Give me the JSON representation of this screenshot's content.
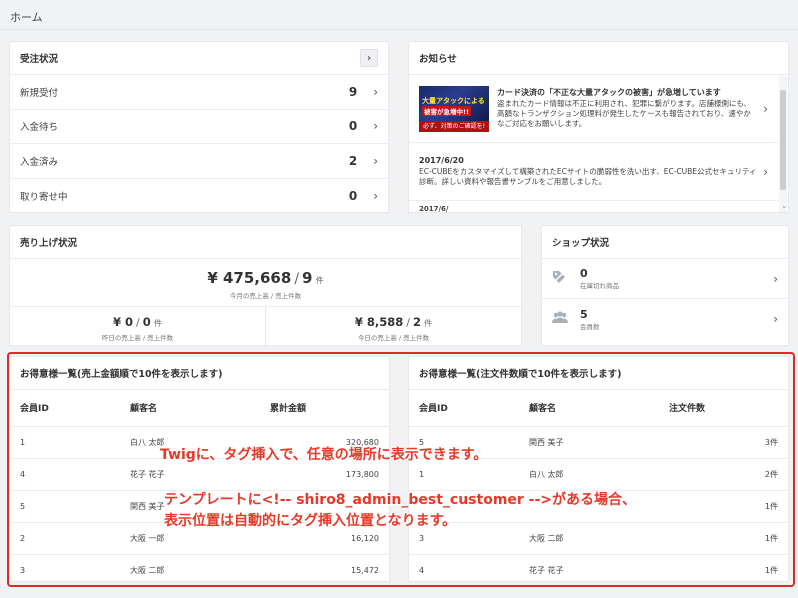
{
  "page": {
    "title": "ホーム"
  },
  "orders": {
    "title": "受注状況",
    "rows": [
      {
        "label": "新規受付",
        "count": "9"
      },
      {
        "label": "入金待ち",
        "count": "0"
      },
      {
        "label": "入金済み",
        "count": "2"
      },
      {
        "label": "取り寄せ中",
        "count": "0"
      }
    ]
  },
  "news": {
    "title": "お知らせ",
    "items": [
      {
        "title": "カード決済の「不正な大量アタックの被害」が急増しています",
        "body": "盗まれたカード情報は不正に利用され、犯罪に繋がります。店舗様側にも、高額なトランザクション処理料が発生したケースも報告されており、速やかなご対応をお願いします。",
        "banner_line1": "大量アタックによる",
        "banner_line2": "被害が急増中!!",
        "banner_line3": "必ず、対策のご確認を!"
      },
      {
        "title": "2017/6/20",
        "body": "EC-CUBEをカスタマイズして構築されたECサイトの脆弱性を洗い出す、EC-CUBE公式セキュリティ診断。詳しい資料や報告書サンプルをご用意しました。"
      }
    ],
    "partial": "2017/6/"
  },
  "sales": {
    "title": "売り上げ状況",
    "month_amount": "¥ 475,668",
    "month_count": "9",
    "month_unit": "件",
    "month_caption": "今月の売上高 / 売上件数",
    "yesterday_amount": "¥ 0",
    "yesterday_count": "0",
    "yesterday_unit": "件",
    "yesterday_caption": "昨日の売上高 / 売上件数",
    "today_amount": "¥ 8,588",
    "today_count": "2",
    "today_unit": "件",
    "today_caption": "今日の売上高 / 売上件数"
  },
  "shop": {
    "title": "ショップ状況",
    "rows": [
      {
        "icon": "tag-icon",
        "value": "0",
        "caption": "在庫切れ商品"
      },
      {
        "icon": "users-icon",
        "value": "5",
        "caption": "会員数"
      }
    ]
  },
  "best_by_amount": {
    "title": "お得意様一覧(売上金額順で10件を表示します)",
    "headers": [
      "会員ID",
      "顧客名",
      "累計金額"
    ],
    "rows": [
      [
        "1",
        "白八 太郎",
        "320,680"
      ],
      [
        "4",
        "花子 花子",
        "173,800"
      ],
      [
        "5",
        "関西 美子",
        ""
      ],
      [
        "2",
        "大阪 一郎",
        "16,120"
      ],
      [
        "3",
        "大阪 二郎",
        "15,472"
      ]
    ]
  },
  "best_by_orders": {
    "title": "お得意様一覧(注文件数順で10件を表示します)",
    "headers": [
      "会員ID",
      "顧客名",
      "注文件数"
    ],
    "rows": [
      [
        "5",
        "関西 美子",
        "3件"
      ],
      [
        "1",
        "白八 太郎",
        "2件"
      ],
      [
        "",
        "",
        "1件"
      ],
      [
        "3",
        "大阪 二郎",
        "1件"
      ],
      [
        "4",
        "花子 花子",
        "1件"
      ]
    ]
  },
  "annotation": {
    "line1": "Twigに、タグ挿入で、任意の場所に表示できます。",
    "line2": "テンプレートに<!-- shiro8_admin_best_customer -->がある場合、",
    "line3": "表示位置は自動的にタグ挿入位置となります。",
    "color": "#e83828"
  }
}
